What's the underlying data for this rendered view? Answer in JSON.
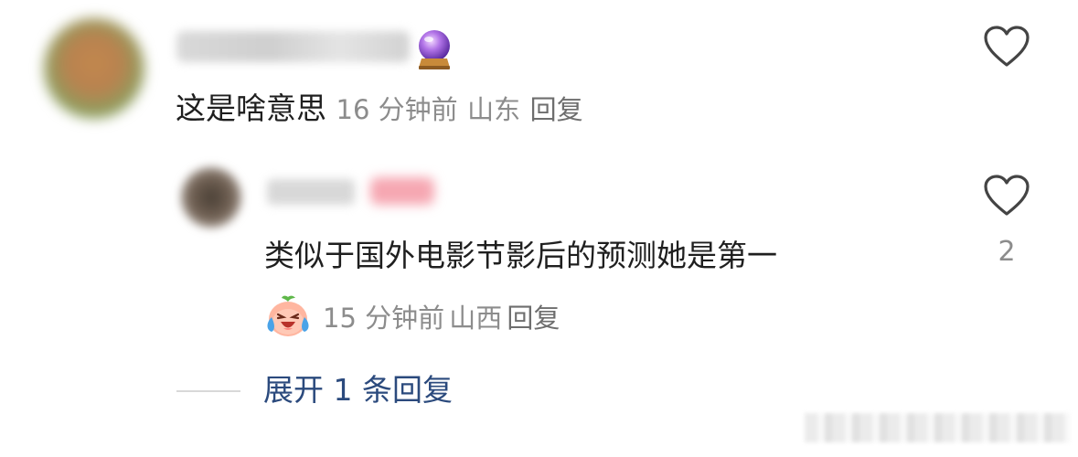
{
  "comment": {
    "text": "这是啥意思",
    "time": "16 分钟前",
    "location": "山东",
    "reply_label": "回复"
  },
  "reply": {
    "text": "类似于国外电影节影后的预测她是第一",
    "time": "15 分钟前",
    "location": "山西",
    "reply_label": "回复",
    "like_count": "2"
  },
  "expand_label": "展开 1 条回复",
  "icons": {
    "like": "heart-outline-icon",
    "user_badge": "crystal-ball-icon",
    "reaction": "laughing-crying-emoji"
  },
  "colors": {
    "link": "#2b4a7d",
    "meta": "#8c8c8c"
  }
}
